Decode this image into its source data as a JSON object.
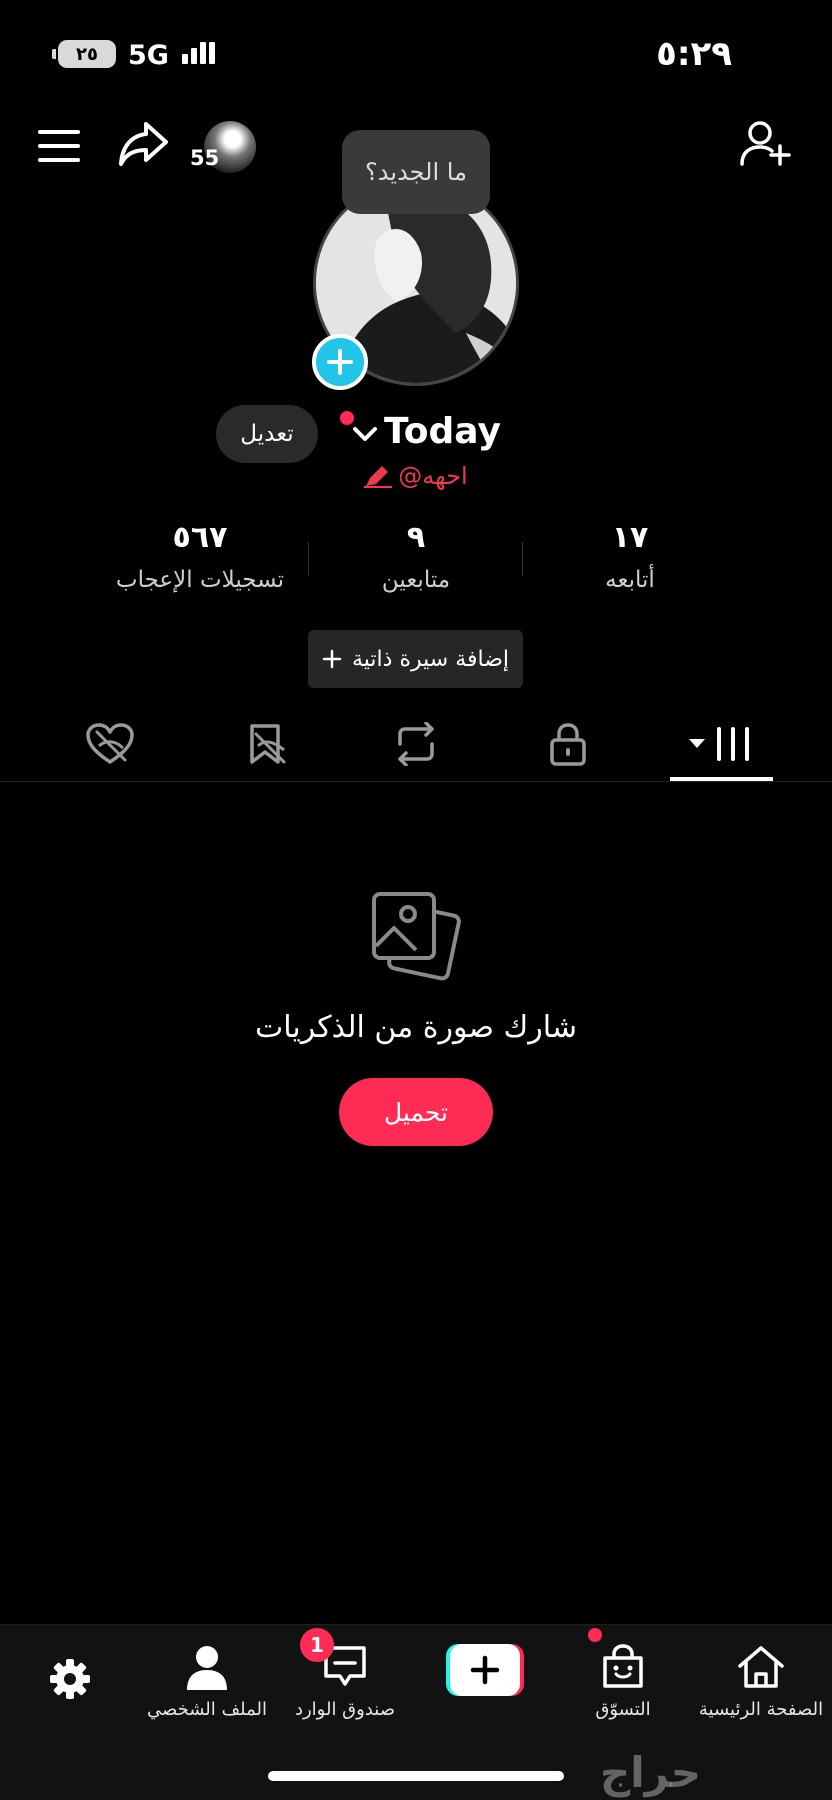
{
  "status_bar": {
    "battery": "٢٥",
    "network": "5G",
    "time": "٥:٢٩"
  },
  "header": {
    "mini_avatar_count": "55",
    "tooltip": "ما الجديد؟"
  },
  "profile": {
    "display_name": "Today",
    "handle": "@احهه",
    "edit_label": "تعديل",
    "add_bio_label": "إضافة سيرة ذاتية"
  },
  "stats": [
    {
      "value": "١٧",
      "label": "أتابعه"
    },
    {
      "value": "٩",
      "label": "متابعين"
    },
    {
      "value": "٥٦٧",
      "label": "تسجيلات الإعجاب"
    }
  ],
  "tabs": [
    {
      "icon": "grid-icon",
      "active": true
    },
    {
      "icon": "lock-icon",
      "active": false
    },
    {
      "icon": "repost-icon",
      "active": false
    },
    {
      "icon": "hidden-bookmark-icon",
      "active": false
    },
    {
      "icon": "hidden-heart-icon",
      "active": false
    }
  ],
  "empty_state": {
    "icon": "photos-icon",
    "text": "شارك صورة من الذكريات",
    "button": "تحميل"
  },
  "bottom_nav": {
    "home": "الصفحة الرئيسية",
    "shop": "التسوّق",
    "inbox": "صندوق الوارد",
    "inbox_badge": "1",
    "profile": "الملف الشخصي"
  },
  "watermark": "حراج",
  "colors": {
    "accent": "#fe2c55",
    "badge_blue": "#22c5e8",
    "background": "#000000"
  }
}
